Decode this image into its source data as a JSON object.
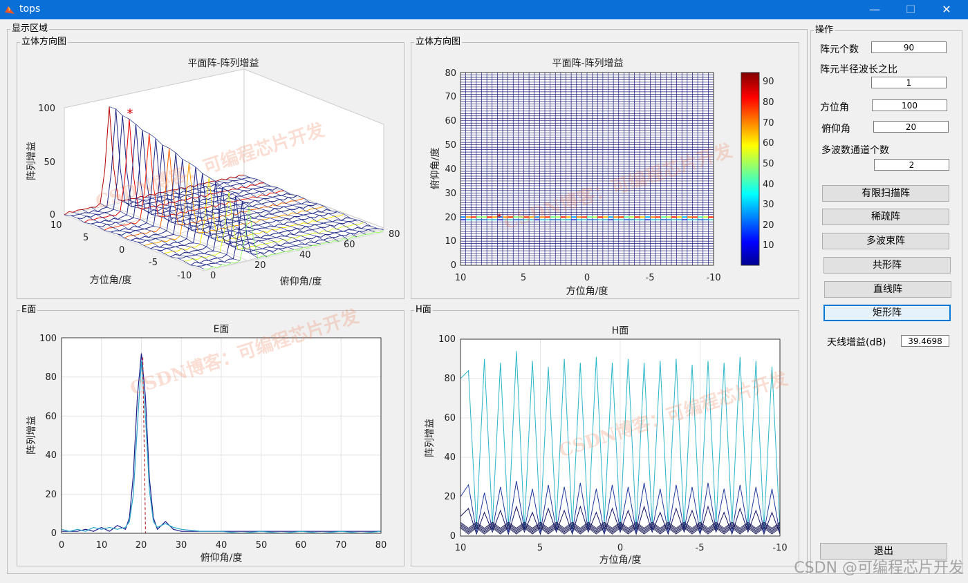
{
  "window": {
    "title": "tops",
    "minimize_glyph": "—",
    "maximize_glyph": "☐",
    "close_glyph": "✕"
  },
  "display_area": {
    "title": "显示区域"
  },
  "panels": {
    "top_left": {
      "group_title": "立体方向图",
      "chart_title": "平面阵-阵列增益",
      "ylabel": "阵列增益",
      "xlabel": "方位角/度",
      "zlabel": "俯仰角/度",
      "zticks": [
        "0",
        "50",
        "100"
      ],
      "az_ticks": [
        "10",
        "5",
        "0",
        "-5",
        "-10"
      ],
      "el_ticks": [
        "0",
        "20",
        "40",
        "60",
        "80"
      ]
    },
    "top_right": {
      "group_title": "立体方向图",
      "chart_title": "平面阵-阵列增益",
      "ylabel": "俯仰角/度",
      "xlabel": "方位角/度",
      "yticks": [
        "0",
        "10",
        "20",
        "30",
        "40",
        "50",
        "60",
        "70",
        "80"
      ],
      "xticks": [
        "10",
        "5",
        "0",
        "-5",
        "-10"
      ],
      "colorbar_ticks": [
        "10",
        "20",
        "30",
        "40",
        "50",
        "60",
        "70",
        "80",
        "90"
      ]
    },
    "bottom_left": {
      "group_title": "E面",
      "chart_title": "E面",
      "ylabel": "阵列增益",
      "xlabel": "俯仰角/度",
      "yticks": [
        "0",
        "20",
        "40",
        "60",
        "80",
        "100"
      ],
      "xticks": [
        "0",
        "10",
        "20",
        "30",
        "40",
        "50",
        "60",
        "70",
        "80"
      ]
    },
    "bottom_right": {
      "group_title": "H面",
      "chart_title": "H面",
      "ylabel": "阵列增益",
      "xlabel": "方位角/度",
      "yticks": [
        "0",
        "20",
        "40",
        "60",
        "80",
        "100"
      ],
      "xticks": [
        "10",
        "5",
        "0",
        "-5",
        "-10"
      ]
    }
  },
  "controls": {
    "group_title": "操作",
    "element_count": {
      "label": "阵元个数",
      "value": "90"
    },
    "radius_ratio": {
      "label": "阵元半径波长之比",
      "value": "1"
    },
    "azimuth": {
      "label": "方位角",
      "value": "100"
    },
    "elevation": {
      "label": "俯仰角",
      "value": "20"
    },
    "multibeam_channels": {
      "label": "多波数通道个数",
      "value": "2"
    },
    "buttons": [
      "有限扫描阵",
      "稀疏阵",
      "多波束阵",
      "共形阵",
      "直线阵",
      "矩形阵"
    ],
    "antenna_gain": {
      "label": "天线增益(dB)",
      "value": "39.4698"
    },
    "exit_label": "退出"
  },
  "watermarks": [
    "CSDN博客：可编程芯片开发",
    "CSDN博客：可编程芯片开发",
    "CSDN博客：可编程芯片开发",
    "CSDN博客：可编程芯片开发"
  ],
  "csdn_footer": "CSDN @可编程芯片开发",
  "chart_data": [
    {
      "type": "line",
      "title": "平面阵-阵列增益",
      "xlabel": "方位角/度",
      "ylabel": "阵列增益",
      "zlabel": "俯仰角/度",
      "kind": "3d-mesh",
      "xlim": [
        -10,
        10
      ],
      "ylim": [
        0,
        80
      ],
      "zlim": [
        0,
        100
      ],
      "peak": {
        "azimuth_deg": 7,
        "elevation_deg": 20,
        "gain": 92
      },
      "ridge_elevation_deg": 20,
      "ridge_peak_gains": [
        90,
        91,
        88,
        86,
        84,
        82,
        80,
        78,
        76,
        74,
        72,
        70,
        68,
        66,
        64,
        62,
        60,
        58,
        56,
        54,
        52,
        50
      ]
    },
    {
      "type": "heatmap",
      "title": "平面阵-阵列增益",
      "xlabel": "方位角/度",
      "ylabel": "俯仰角/度",
      "xlim": [
        10,
        -10
      ],
      "ylim": [
        0,
        80
      ],
      "colorbar_range": [
        0,
        95
      ],
      "peak_marker": {
        "azimuth_deg": 7,
        "elevation_deg": 20
      },
      "band_elevation_deg": 20
    },
    {
      "type": "line",
      "title": "E面",
      "xlabel": "俯仰角/度",
      "ylabel": "阵列增益",
      "xlim": [
        0,
        80
      ],
      "ylim": [
        0,
        100
      ],
      "grid": true,
      "x": [
        0,
        2,
        4,
        6,
        8,
        10,
        12,
        14,
        16,
        17,
        18,
        19,
        20,
        21,
        22,
        23,
        24,
        26,
        28,
        30,
        35,
        40,
        45,
        50,
        55,
        60,
        65,
        70,
        75,
        80
      ],
      "series": [
        {
          "values": [
            1,
            1,
            1,
            2,
            1,
            3,
            1,
            4,
            2,
            8,
            30,
            70,
            92,
            70,
            28,
            8,
            2,
            6,
            2,
            1,
            1,
            1,
            1,
            1,
            1,
            1,
            1,
            1,
            1,
            1
          ]
        },
        {
          "values": [
            2,
            1,
            2,
            1,
            3,
            2,
            3,
            2,
            3,
            6,
            20,
            55,
            88,
            60,
            22,
            6,
            3,
            5,
            3,
            2,
            1,
            1,
            0,
            1,
            0,
            1,
            0,
            1,
            0,
            1
          ]
        }
      ]
    },
    {
      "type": "line",
      "title": "H面",
      "xlabel": "方位角/度",
      "ylabel": "阵列增益",
      "xlim": [
        10,
        -10
      ],
      "ylim": [
        0,
        100
      ],
      "grid": true,
      "x": [
        10,
        9.5,
        9,
        8.5,
        8,
        7.5,
        7,
        6.5,
        6,
        5.5,
        5,
        4.5,
        4,
        3.5,
        3,
        2.5,
        2,
        1.5,
        1,
        0.5,
        0,
        -0.5,
        -1,
        -1.5,
        -2,
        -2.5,
        -3,
        -3.5,
        -4,
        -4.5,
        -5,
        -5.5,
        -6,
        -6.5,
        -7,
        -7.5,
        -8,
        -8.5,
        -9,
        -9.5,
        -10
      ],
      "series": [
        {
          "values": [
            80,
            84,
            4,
            90,
            6,
            88,
            5,
            94,
            4,
            89,
            5,
            86,
            6,
            90,
            4,
            88,
            5,
            91,
            6,
            88,
            5,
            90,
            4,
            88,
            6,
            89,
            5,
            90,
            4,
            87,
            6,
            89,
            5,
            88,
            6,
            91,
            5,
            89,
            4,
            86,
            3
          ]
        },
        {
          "values": [
            20,
            26,
            2,
            22,
            3,
            25,
            2,
            28,
            3,
            24,
            2,
            26,
            3,
            25,
            2,
            27,
            3,
            24,
            2,
            26,
            3,
            25,
            2,
            27,
            3,
            24,
            2,
            26,
            3,
            25,
            2,
            27,
            3,
            24,
            2,
            26,
            3,
            25,
            2,
            24,
            1
          ]
        },
        {
          "values": [
            10,
            14,
            1,
            12,
            2,
            13,
            1,
            15,
            2,
            12,
            1,
            14,
            2,
            13,
            1,
            15,
            2,
            12,
            1,
            14,
            2,
            13,
            1,
            15,
            2,
            12,
            1,
            14,
            2,
            13,
            1,
            15,
            2,
            12,
            1,
            14,
            2,
            13,
            1,
            12,
            1
          ]
        }
      ]
    }
  ]
}
